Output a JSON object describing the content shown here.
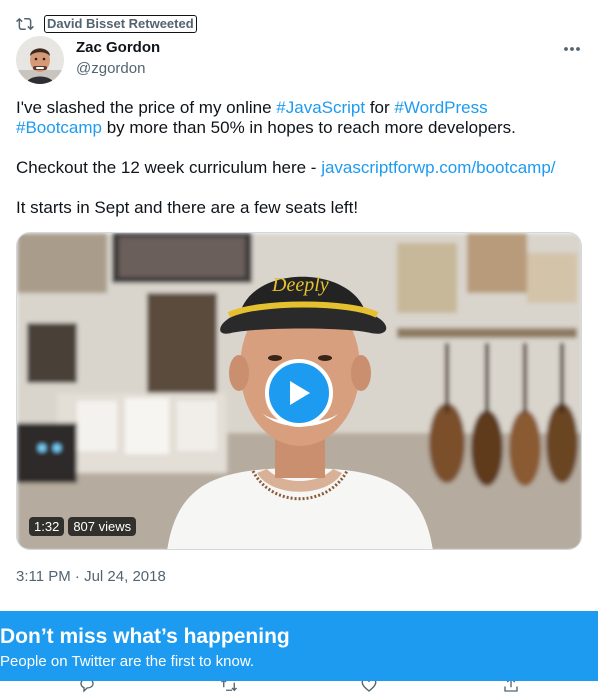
{
  "retweet": {
    "label": "David Bisset Retweeted",
    "icon": "retweet-icon"
  },
  "author": {
    "name": "Zac Gordon",
    "handle": "@zgordon"
  },
  "tweet": {
    "line1_prefix": "I've slashed the price of my online ",
    "hashtag_javascript": "#JavaScript",
    "line1_mid": " for ",
    "hashtag_wordpress": "#WordPress",
    "hashtag_bootcamp": "#Bootcamp",
    "line2_suffix": " by more than 50% in hopes to reach more developers.",
    "curriculum_prefix": "Checkout the 12 week curriculum here - ",
    "curriculum_link": "javascriptforwp.com/bootcamp/",
    "closing": "It starts in Sept and there are a few seats left!"
  },
  "video": {
    "duration": "1:32",
    "views": "807 views",
    "cap_text": "Deeply"
  },
  "timestamp": "3:11 PM · Jul 24, 2018",
  "banner": {
    "title": "Don’t miss what’s happening",
    "subtitle": "People on Twitter are the first to know."
  },
  "colors": {
    "accent": "#1d9bf0",
    "text": "#0f1419",
    "secondary": "#536471"
  }
}
